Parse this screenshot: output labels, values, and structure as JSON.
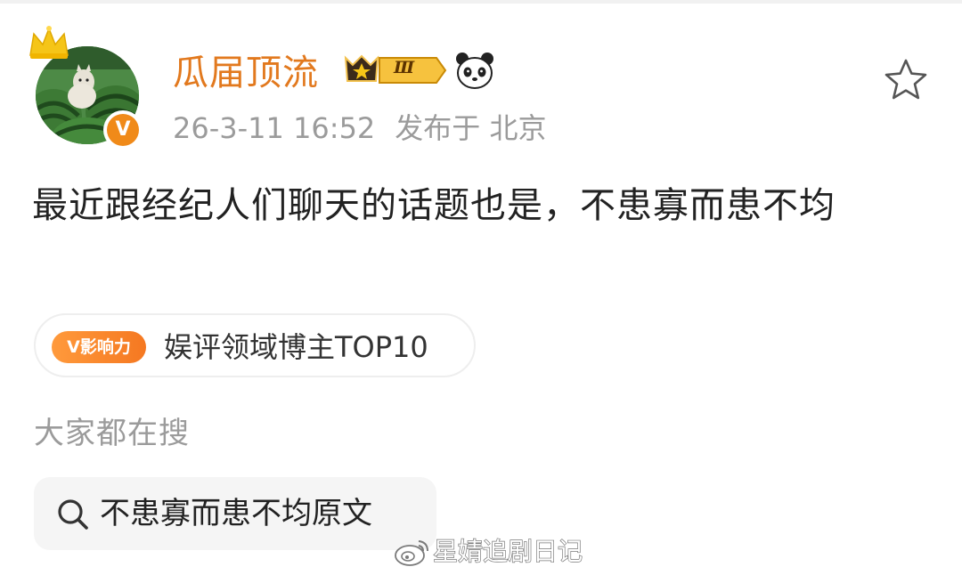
{
  "post": {
    "username": "瓜届顶流",
    "level_badge": "Ⅲ",
    "verified_mark": "V",
    "timestamp": "26-3-11 16:52",
    "location": "发布于 北京",
    "text": "最近跟经纪人们聊天的话题也是，不患寡而患不均"
  },
  "influence": {
    "pill_label": "V影响力",
    "tag_text": "娱评领域博主TOP10",
    "accent_color": "#f57821"
  },
  "search": {
    "section_label": "大家都在搜",
    "query": "不患寡而患不均原文"
  },
  "watermark": {
    "text": "星婧追剧日记"
  },
  "icons": {
    "favorite": "star-outline-icon",
    "search": "search-icon",
    "member_crown": "crown-icon",
    "level": "level-badge-icon",
    "panda": "panda-icon",
    "weibo": "weibo-logo-icon"
  },
  "colors": {
    "username": "#e2791e",
    "meta": "#9b9b9b",
    "verified": "#f08a19",
    "chip_bg": "#f5f5f5"
  }
}
